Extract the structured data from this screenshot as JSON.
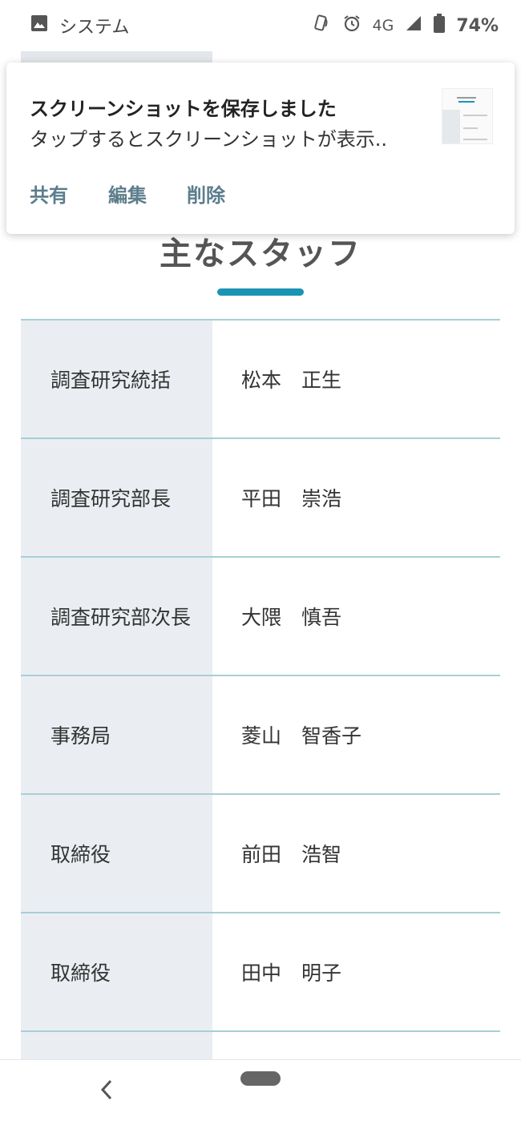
{
  "status_bar": {
    "app_name": "システム",
    "network": "4G",
    "battery": "74%"
  },
  "notification": {
    "title": "スクリーンショットを保存しました",
    "body": "タップするとスクリーンショットが表示..",
    "actions": {
      "share": "共有",
      "edit": "編集",
      "delete": "削除"
    }
  },
  "page": {
    "section_title": "主なスタッフ",
    "staff": [
      {
        "role": "調査研究統括",
        "name": "松本　正生"
      },
      {
        "role": "調査研究部長",
        "name": "平田　崇浩"
      },
      {
        "role": "調査研究部次長",
        "name": "大隈　慎吾"
      },
      {
        "role": "事務局",
        "name": "菱山　智香子"
      },
      {
        "role": "取締役",
        "name": "前田　浩智"
      },
      {
        "role": "取締役",
        "name": "田中　明子"
      }
    ]
  },
  "nav_bar": {
    "back_icon": "chevron-left-icon",
    "home_icon": "home-pill-icon"
  }
}
